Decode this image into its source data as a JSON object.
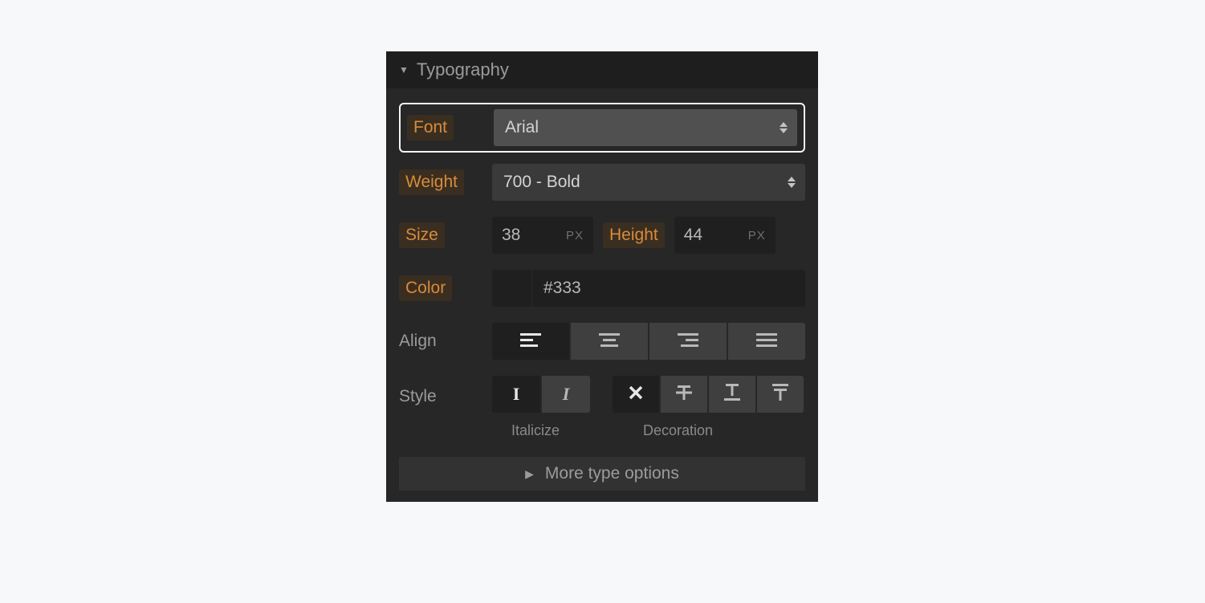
{
  "panel": {
    "title": "Typography"
  },
  "font": {
    "label": "Font",
    "value": "Arial"
  },
  "weight": {
    "label": "Weight",
    "value": "700 - Bold"
  },
  "size": {
    "label": "Size",
    "value": "38",
    "unit": "PX"
  },
  "height": {
    "label": "Height",
    "value": "44",
    "unit": "PX"
  },
  "color": {
    "label": "Color",
    "value": "#333"
  },
  "align": {
    "label": "Align"
  },
  "style": {
    "label": "Style",
    "italicize_label": "Italicize",
    "decoration_label": "Decoration"
  },
  "more": {
    "label": "More type options"
  }
}
